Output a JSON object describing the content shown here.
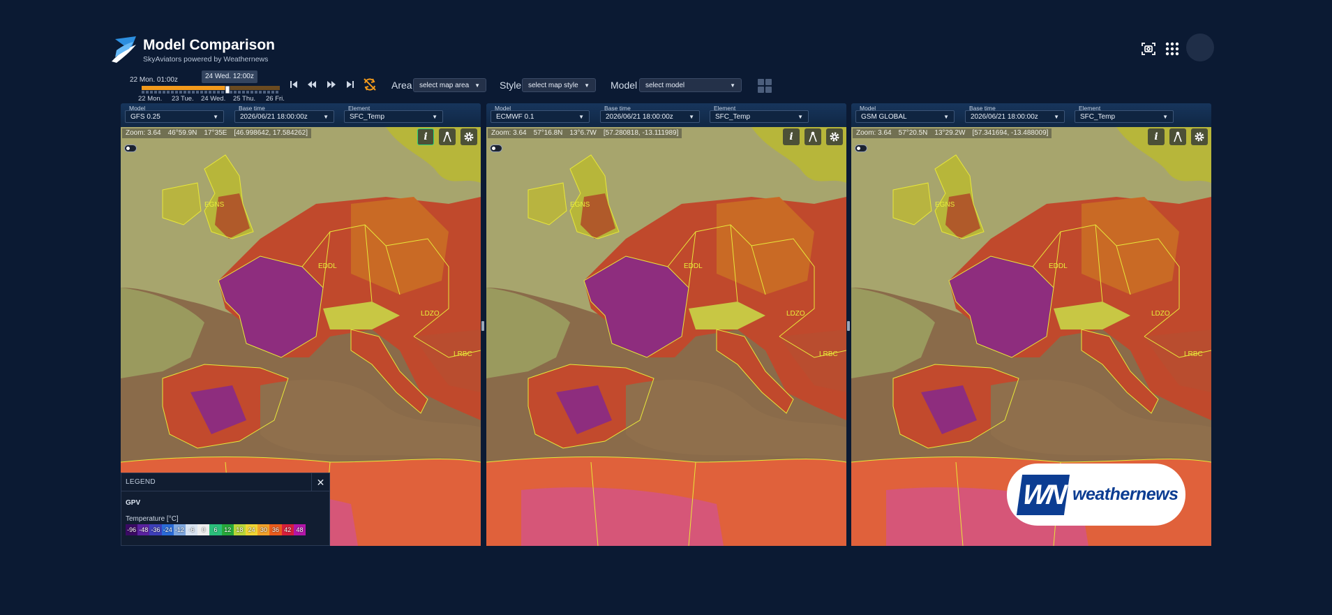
{
  "header": {
    "title": "Model Comparison",
    "subtitle": "SkyAviators powered by Weathernews",
    "icons": [
      "screenshot-icon",
      "apps-grid-icon",
      "avatar"
    ]
  },
  "timeline": {
    "start_label": "22 Mon. 01:00z",
    "current_label": "24 Wed. 12:00z",
    "days": [
      "22 Mon.",
      "23 Tue.",
      "24 Wed.",
      "25 Thu.",
      "26 Fri."
    ],
    "progress": 0.5
  },
  "controls": {
    "area_label": "Area",
    "area_placeholder": "select map area",
    "style_label": "Style",
    "style_placeholder": "select map style",
    "model_label": "Model",
    "model_placeholder": "select model"
  },
  "panels": [
    {
      "model_label": "Model",
      "model": "GFS 0.25",
      "base_label": "Base time",
      "base": "2026/06/21 18:00:00z",
      "element_label": "Element",
      "element": "SFC_Temp",
      "zoom": "Zoom: 3.64",
      "lat": "46°59.9N",
      "lon": "17°35E",
      "latlon": "[46.998642, 17.584262]"
    },
    {
      "model_label": "Model",
      "model": "ECMWF 0.1",
      "base_label": "Base time",
      "base": "2026/06/21 18:00:00z",
      "element_label": "Element",
      "element": "SFC_Temp",
      "zoom": "Zoom: 3.64",
      "lat": "57°16.8N",
      "lon": "13°6.7W",
      "latlon": "[57.280818, -13.111989]"
    },
    {
      "model_label": "Model",
      "model": "GSM GLOBAL",
      "base_label": "Base time",
      "base": "2026/06/21 18:00:00z",
      "element_label": "Element",
      "element": "SFC_Temp",
      "zoom": "Zoom: 3.64",
      "lat": "57°20.5N",
      "lon": "13°29.2W",
      "latlon": "[57.341694, -13.488009]"
    }
  ],
  "map_labels": [
    "EGNS",
    "EDDL",
    "LDZO",
    "LRBC"
  ],
  "legend": {
    "title": "LEGEND",
    "close": "✕",
    "source": "GPV",
    "unit": "Temperature [°C]",
    "values": [
      "-96",
      "-48",
      "-36",
      "-24",
      "-12",
      "-6",
      "0",
      "6",
      "12",
      "18",
      "24",
      "30",
      "36",
      "42",
      "48"
    ],
    "colors": [
      "#3a0a63",
      "#5a22a0",
      "#3d3fb8",
      "#2a6bd8",
      "#7fa8e0",
      "#d8e3f1",
      "#eeeeee",
      "#2bbf7a",
      "#27a83a",
      "#b9d63a",
      "#f0d534",
      "#f1a12a",
      "#ea5c1c",
      "#d61f3b",
      "#b316a8"
    ]
  },
  "brand": {
    "mark": "WN",
    "name": "weathernews"
  },
  "colors": {
    "bg": "#0b1a33",
    "accent": "#f5a623",
    "hot": "#c8342a",
    "very_hot": "#8a2b8c"
  }
}
